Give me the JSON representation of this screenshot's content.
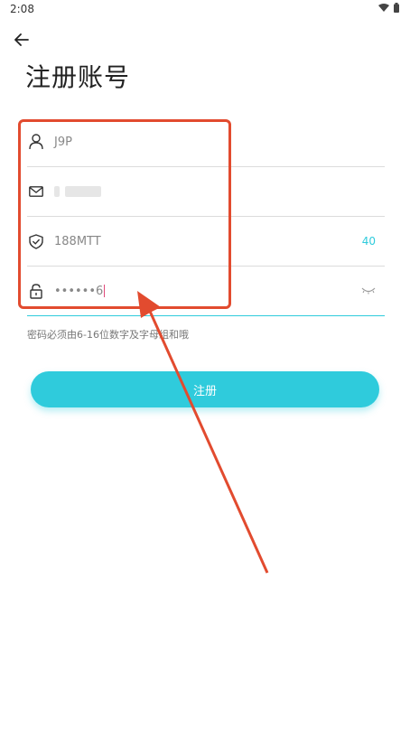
{
  "status_bar": {
    "time": "2:08"
  },
  "header": {
    "title": "注册账号"
  },
  "form": {
    "username": {
      "value": "J9P"
    },
    "email": {
      "value": ""
    },
    "verification": {
      "value": "188MTT",
      "code_button": "40"
    },
    "password": {
      "value": "••••••6"
    }
  },
  "hint": "密码必须由6-16位数字及字母组和哦",
  "register_button": "注册",
  "colors": {
    "accent": "#2fcbdc",
    "annotation": "#e24b2f"
  },
  "icons": {
    "status": [
      "wifi-icon",
      "battery-icon"
    ],
    "back": "back-arrow-icon",
    "username": "user-icon",
    "email": "mail-icon",
    "verification": "shield-check-icon",
    "password": "lock-icon",
    "eye": "eye-closed-icon"
  }
}
